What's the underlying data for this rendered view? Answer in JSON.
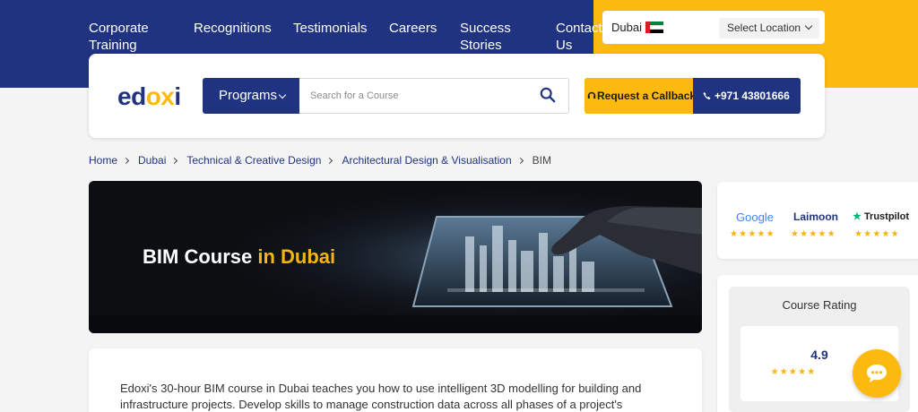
{
  "nav": {
    "items": [
      {
        "line1": "Corporate",
        "line2": "Training"
      },
      {
        "line1": "Recognitions",
        "line2": ""
      },
      {
        "line1": "Testimonials",
        "line2": ""
      },
      {
        "line1": "Careers",
        "line2": ""
      },
      {
        "line1": "Success",
        "line2": "Stories"
      },
      {
        "line1": "Contact",
        "line2": "Us"
      }
    ]
  },
  "location": {
    "city": "Dubai",
    "select_label": "Select Location",
    "flag_colors": {
      "red": "#d32027",
      "green": "#00843d",
      "white": "#ffffff",
      "black": "#000000"
    }
  },
  "header": {
    "logo_pre": "ed",
    "logo_mid": "ox",
    "logo_post": "i",
    "programs_label": "Programs",
    "search_placeholder": "Search for a Course",
    "callback_label": "Request a Callback",
    "phone_label": "+971 43801666"
  },
  "breadcrumb": {
    "items": [
      "Home",
      "Dubai",
      "Technical & Creative Design",
      "Architectural Design & Visualisation"
    ],
    "current": "BIM"
  },
  "hero": {
    "title_main": "BIM Course ",
    "title_accent": "in Dubai"
  },
  "description": {
    "text": "Edoxi's 30-hour BIM course in Dubai teaches you how to use intelligent 3D modelling for building and infrastructure projects. Develop skills to manage construction data across all phases of a project's"
  },
  "reviews": {
    "google": "Google",
    "laimoon": "Laimoon",
    "trustpilot": "Trustpilot",
    "stars": "★★★★★"
  },
  "rating": {
    "label": "Course Rating",
    "value": "4.9",
    "stars": "★★★★★"
  },
  "colors": {
    "navy": "#1f3381",
    "yellow": "#fcb90f",
    "accent_gold": "#f6b416"
  }
}
